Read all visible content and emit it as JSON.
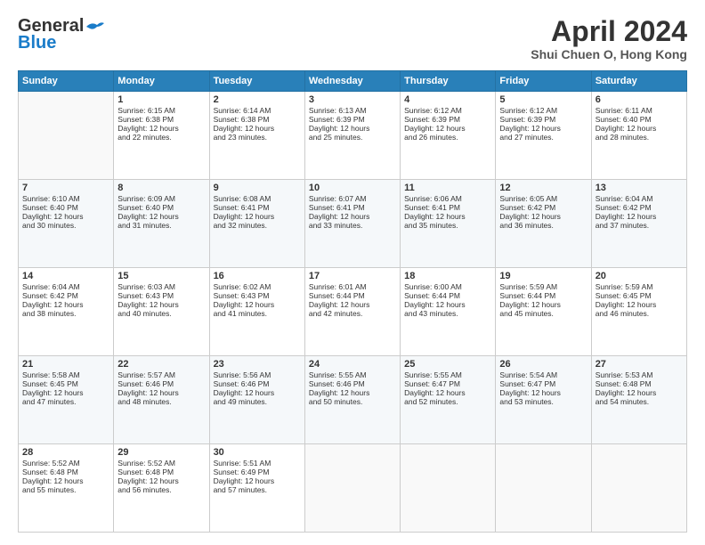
{
  "header": {
    "month_title": "April 2024",
    "location": "Shui Chuen O, Hong Kong",
    "logo_general": "General",
    "logo_blue": "Blue"
  },
  "days_of_week": [
    "Sunday",
    "Monday",
    "Tuesday",
    "Wednesday",
    "Thursday",
    "Friday",
    "Saturday"
  ],
  "weeks": [
    [
      {
        "day": "",
        "data": ""
      },
      {
        "day": "1",
        "data": "Sunrise: 6:15 AM\nSunset: 6:38 PM\nDaylight: 12 hours\nand 22 minutes."
      },
      {
        "day": "2",
        "data": "Sunrise: 6:14 AM\nSunset: 6:38 PM\nDaylight: 12 hours\nand 23 minutes."
      },
      {
        "day": "3",
        "data": "Sunrise: 6:13 AM\nSunset: 6:39 PM\nDaylight: 12 hours\nand 25 minutes."
      },
      {
        "day": "4",
        "data": "Sunrise: 6:12 AM\nSunset: 6:39 PM\nDaylight: 12 hours\nand 26 minutes."
      },
      {
        "day": "5",
        "data": "Sunrise: 6:12 AM\nSunset: 6:39 PM\nDaylight: 12 hours\nand 27 minutes."
      },
      {
        "day": "6",
        "data": "Sunrise: 6:11 AM\nSunset: 6:40 PM\nDaylight: 12 hours\nand 28 minutes."
      }
    ],
    [
      {
        "day": "7",
        "data": "Sunrise: 6:10 AM\nSunset: 6:40 PM\nDaylight: 12 hours\nand 30 minutes."
      },
      {
        "day": "8",
        "data": "Sunrise: 6:09 AM\nSunset: 6:40 PM\nDaylight: 12 hours\nand 31 minutes."
      },
      {
        "day": "9",
        "data": "Sunrise: 6:08 AM\nSunset: 6:41 PM\nDaylight: 12 hours\nand 32 minutes."
      },
      {
        "day": "10",
        "data": "Sunrise: 6:07 AM\nSunset: 6:41 PM\nDaylight: 12 hours\nand 33 minutes."
      },
      {
        "day": "11",
        "data": "Sunrise: 6:06 AM\nSunset: 6:41 PM\nDaylight: 12 hours\nand 35 minutes."
      },
      {
        "day": "12",
        "data": "Sunrise: 6:05 AM\nSunset: 6:42 PM\nDaylight: 12 hours\nand 36 minutes."
      },
      {
        "day": "13",
        "data": "Sunrise: 6:04 AM\nSunset: 6:42 PM\nDaylight: 12 hours\nand 37 minutes."
      }
    ],
    [
      {
        "day": "14",
        "data": "Sunrise: 6:04 AM\nSunset: 6:42 PM\nDaylight: 12 hours\nand 38 minutes."
      },
      {
        "day": "15",
        "data": "Sunrise: 6:03 AM\nSunset: 6:43 PM\nDaylight: 12 hours\nand 40 minutes."
      },
      {
        "day": "16",
        "data": "Sunrise: 6:02 AM\nSunset: 6:43 PM\nDaylight: 12 hours\nand 41 minutes."
      },
      {
        "day": "17",
        "data": "Sunrise: 6:01 AM\nSunset: 6:44 PM\nDaylight: 12 hours\nand 42 minutes."
      },
      {
        "day": "18",
        "data": "Sunrise: 6:00 AM\nSunset: 6:44 PM\nDaylight: 12 hours\nand 43 minutes."
      },
      {
        "day": "19",
        "data": "Sunrise: 5:59 AM\nSunset: 6:44 PM\nDaylight: 12 hours\nand 45 minutes."
      },
      {
        "day": "20",
        "data": "Sunrise: 5:59 AM\nSunset: 6:45 PM\nDaylight: 12 hours\nand 46 minutes."
      }
    ],
    [
      {
        "day": "21",
        "data": "Sunrise: 5:58 AM\nSunset: 6:45 PM\nDaylight: 12 hours\nand 47 minutes."
      },
      {
        "day": "22",
        "data": "Sunrise: 5:57 AM\nSunset: 6:46 PM\nDaylight: 12 hours\nand 48 minutes."
      },
      {
        "day": "23",
        "data": "Sunrise: 5:56 AM\nSunset: 6:46 PM\nDaylight: 12 hours\nand 49 minutes."
      },
      {
        "day": "24",
        "data": "Sunrise: 5:55 AM\nSunset: 6:46 PM\nDaylight: 12 hours\nand 50 minutes."
      },
      {
        "day": "25",
        "data": "Sunrise: 5:55 AM\nSunset: 6:47 PM\nDaylight: 12 hours\nand 52 minutes."
      },
      {
        "day": "26",
        "data": "Sunrise: 5:54 AM\nSunset: 6:47 PM\nDaylight: 12 hours\nand 53 minutes."
      },
      {
        "day": "27",
        "data": "Sunrise: 5:53 AM\nSunset: 6:48 PM\nDaylight: 12 hours\nand 54 minutes."
      }
    ],
    [
      {
        "day": "28",
        "data": "Sunrise: 5:52 AM\nSunset: 6:48 PM\nDaylight: 12 hours\nand 55 minutes."
      },
      {
        "day": "29",
        "data": "Sunrise: 5:52 AM\nSunset: 6:48 PM\nDaylight: 12 hours\nand 56 minutes."
      },
      {
        "day": "30",
        "data": "Sunrise: 5:51 AM\nSunset: 6:49 PM\nDaylight: 12 hours\nand 57 minutes."
      },
      {
        "day": "",
        "data": ""
      },
      {
        "day": "",
        "data": ""
      },
      {
        "day": "",
        "data": ""
      },
      {
        "day": "",
        "data": ""
      }
    ]
  ]
}
